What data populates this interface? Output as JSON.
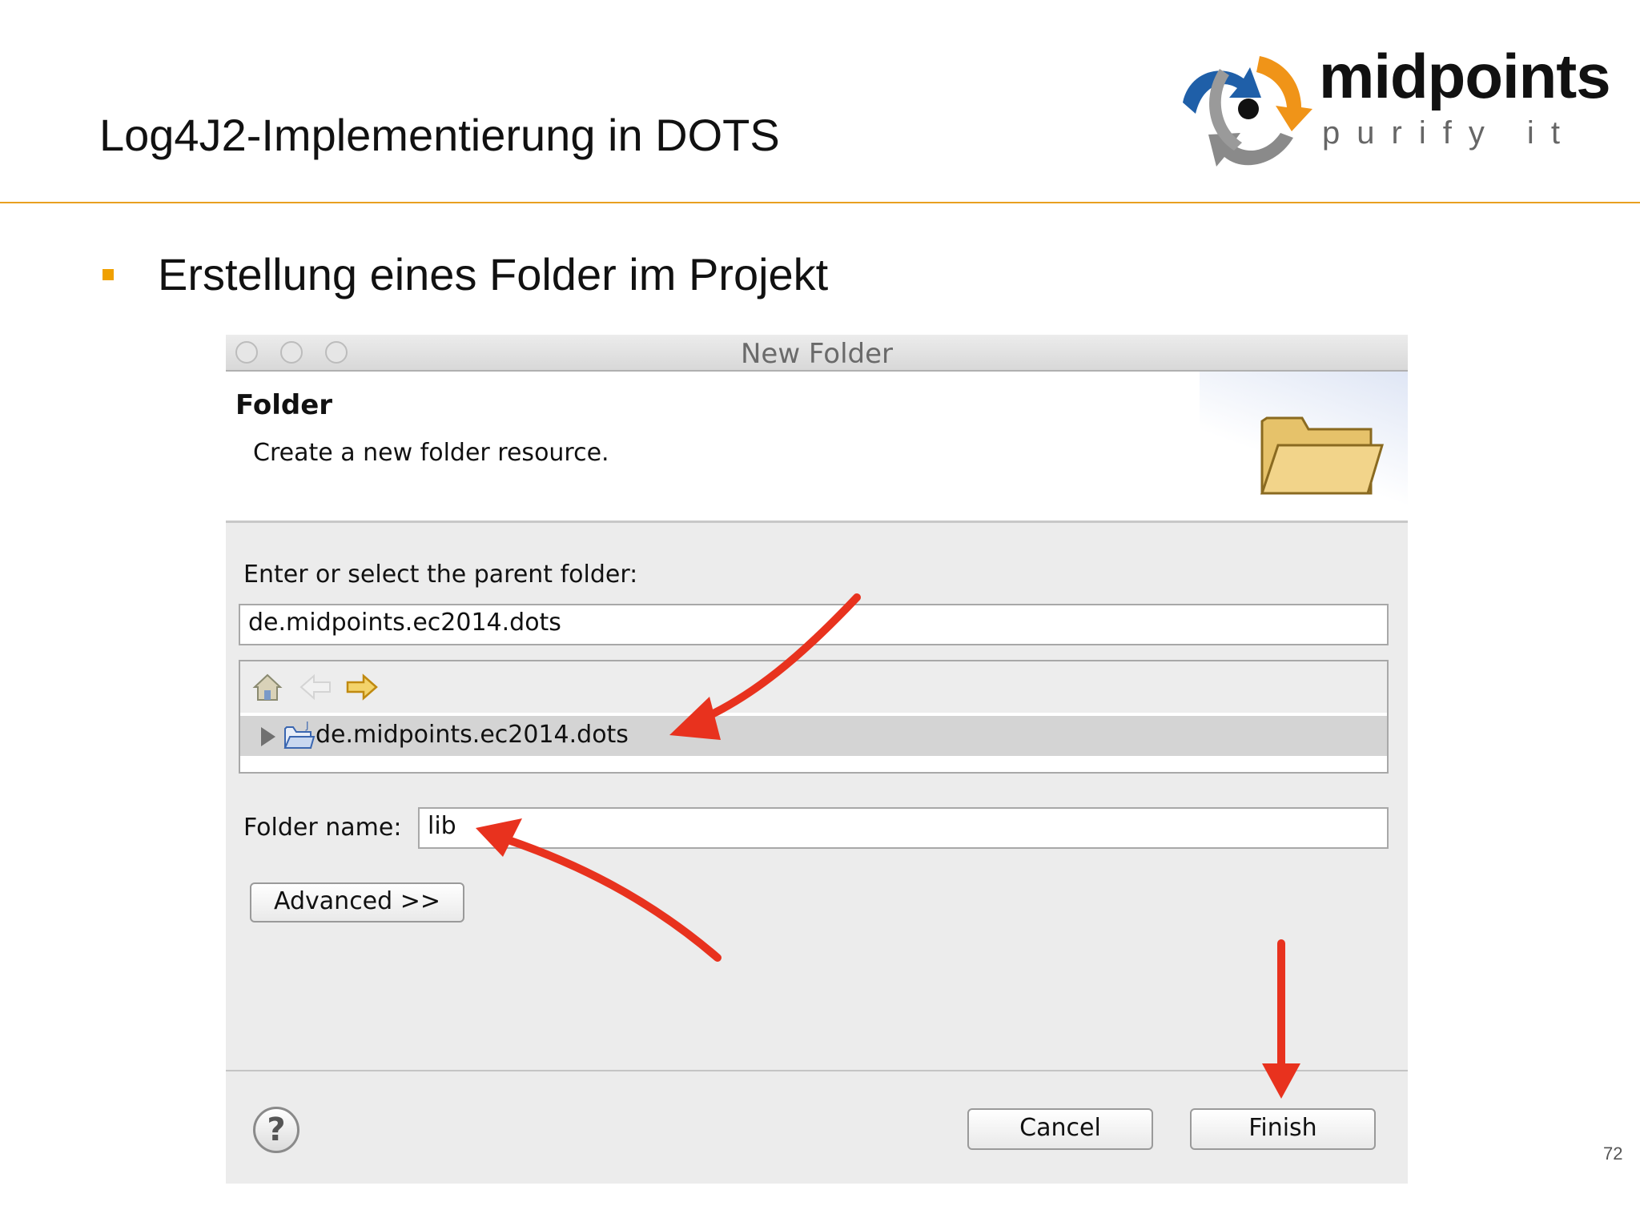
{
  "slide": {
    "title": "Log4J2-Implementierung in DOTS",
    "bullet": "Erstellung eines Folder im Projekt",
    "page_number": "72"
  },
  "logo": {
    "wordmark": "midpoints",
    "tagline": "purify it"
  },
  "dialog": {
    "window_title": "New Folder",
    "heading": "Folder",
    "description": "Create a new folder resource.",
    "parent_label": "Enter or select the parent folder:",
    "parent_value": "de.midpoints.ec2014.dots",
    "tree": {
      "items": [
        {
          "label": "de.midpoints.ec2014.dots",
          "selected": true
        }
      ]
    },
    "folder_name_label": "Folder name:",
    "folder_name_value": "lib",
    "advanced_button": "Advanced >>",
    "cancel_button": "Cancel",
    "finish_button": "Finish",
    "help_symbol": "?"
  },
  "colors": {
    "accent_orange": "#f0a000",
    "arrow_red": "#e8321e",
    "logo_blue": "#1f5fa8",
    "logo_orange": "#f09418"
  },
  "icons": [
    "home-icon",
    "back-arrow-icon",
    "forward-arrow-icon",
    "folder-icon",
    "project-folder-icon",
    "help-icon"
  ]
}
